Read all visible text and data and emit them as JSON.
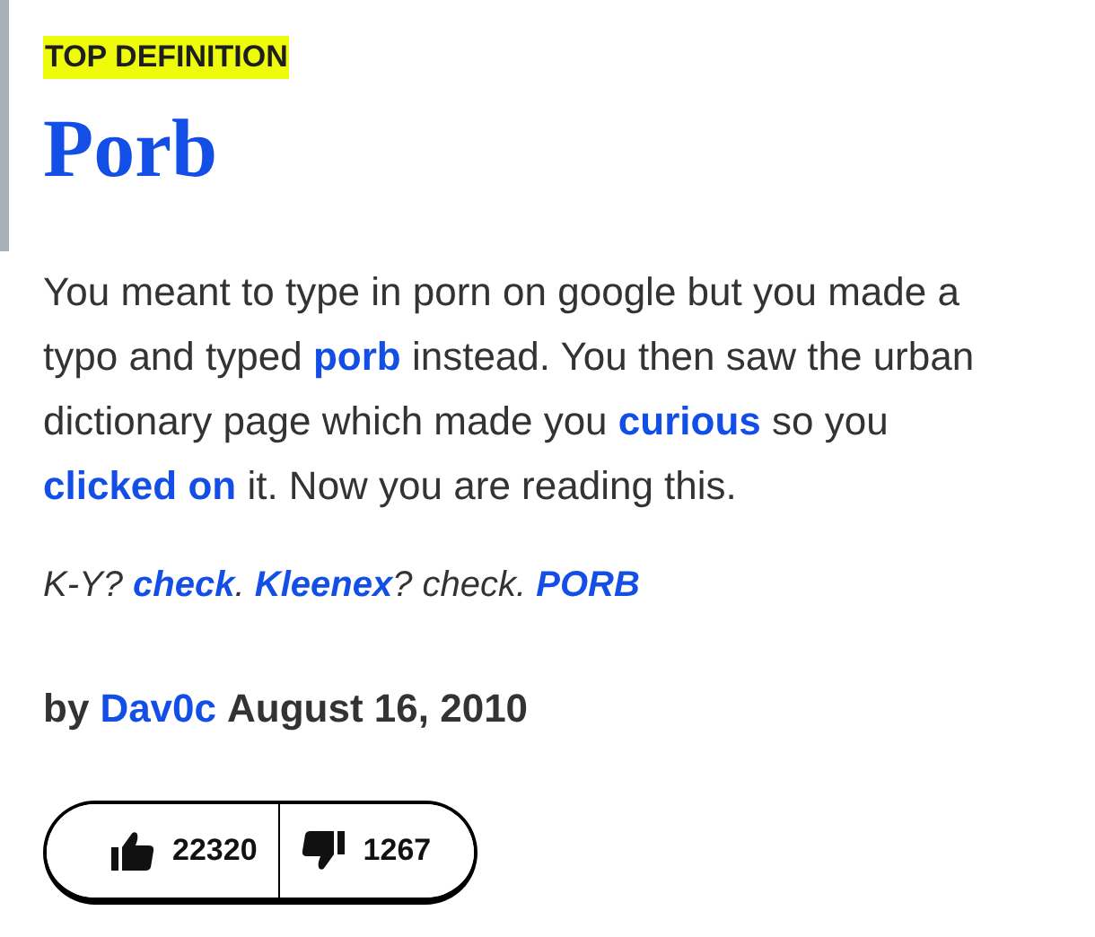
{
  "label": "TOP DEFINITION",
  "word": "Porb",
  "meaning": [
    {
      "text": "You meant to type in porn on google but you made a typo and typed ",
      "link": false
    },
    {
      "text": "porb",
      "link": true
    },
    {
      "text": " instead. You then saw the urban dictionary page which made you ",
      "link": false
    },
    {
      "text": "curious",
      "link": true
    },
    {
      "text": " so you ",
      "link": false
    },
    {
      "text": "clicked on",
      "link": true
    },
    {
      "text": " it. Now you are reading this.",
      "link": false
    }
  ],
  "example": [
    {
      "text": "K-Y? ",
      "link": false
    },
    {
      "text": "check",
      "link": true
    },
    {
      "text": ". ",
      "link": false
    },
    {
      "text": "Kleenex",
      "link": true
    },
    {
      "text": "? check. ",
      "link": false
    },
    {
      "text": "PORB",
      "link": true
    }
  ],
  "byline": {
    "prefix": "by",
    "author": "Dav0c",
    "date": "August 16, 2010"
  },
  "votes": {
    "up": "22320",
    "down": "1267"
  }
}
